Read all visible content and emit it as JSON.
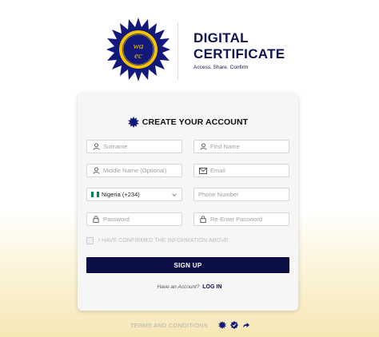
{
  "brand": {
    "title_line1": "DIGITAL",
    "title_line2": "CERTIFICATE",
    "tagline": "Access. Share. Confirm",
    "logo_text": "waec",
    "logo_ring_text": "WEST AFRICAN EXAMINATIONS COUNCIL"
  },
  "card": {
    "title": "CREATE YOUR ACCOUNT",
    "fields": {
      "surname": "Surname",
      "first_name": "First Name",
      "middle_name": "Middle Name (Optional)",
      "email": "Email",
      "country": "Nigeria (+234)",
      "phone": "Phone Number",
      "password": "Password",
      "reenter_password": "Re-Enter Password"
    },
    "confirm_label": "I HAVE CONFIRMED THE INFORMATION ABOVE",
    "signup_label": "SIGN UP",
    "login_question": "Have an Account?",
    "login_link": "LOG IN"
  },
  "footer": {
    "terms": "TERMS AND CONDITIONS",
    "icons": [
      "seal-icon",
      "verified-icon",
      "share-icon"
    ]
  },
  "colors": {
    "navy": "#0c0f45",
    "gold": "#f5c400",
    "flag_green": "#008751"
  }
}
